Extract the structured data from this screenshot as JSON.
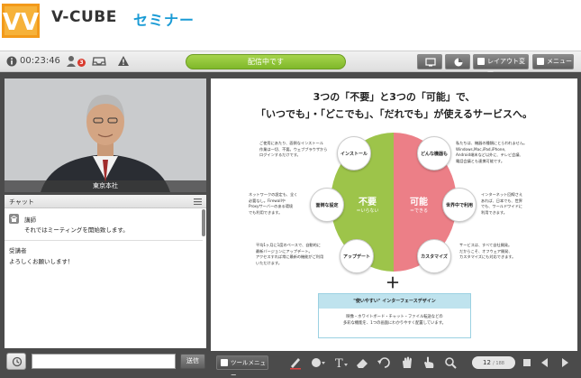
{
  "brand": {
    "name_a": "V-CUBE",
    "name_b": "セミナー",
    "logo_letters": "VV"
  },
  "toolbar": {
    "info_icon": "info-icon",
    "timer": "00:23:46",
    "participants_badge": "3",
    "status": "配信中です",
    "layout_label": "レイアウト変更",
    "menu_label": "メニュー"
  },
  "video": {
    "label": "東京本社"
  },
  "chat": {
    "title": "チャット",
    "messages": [
      {
        "name": "講師",
        "text": "それではミーティングを開始致します。"
      },
      {
        "name": "受講者",
        "text": "よろしくお願いします！"
      }
    ],
    "send_label": "送信",
    "input_value": ""
  },
  "slide": {
    "title_line1": "3つの「不要」と3つの「可能」で、",
    "title_line2": "「いつでも」・「どこでも」、「だれでも」が使えるサービスへ。",
    "left_center": {
      "big": "不要",
      "sub": "＝いらない"
    },
    "right_center": {
      "big": "可能",
      "sub": "＝できる"
    },
    "nodes": {
      "install": "インストール",
      "complex": "面倒な設定",
      "update": "アップデート",
      "device": "どんな機器も",
      "world": "世界中で利用",
      "custom": "カスタマイズ"
    },
    "descs": {
      "install": "ご使用にあたり、面倒なインストール\n作業は一切、不要。ウェブブラウザから\nログインするだけです。",
      "complex": "ネットワークの設定も、全く\n必要なし。Firewallや\nProxyサーバーのある環境\nでも利用できます。",
      "update": "平均1ヶ月に1度のペースで、自動的に\n最新バージョンにアップデート。\nアクセスすれば常に最新の機能がご利用\nいただけます。",
      "device": "私たちは、機器の種類にとらわれません。\nWindows,Mac,iPad,iPhone,\nAndroid端末など以外に、テレビ会議、\n電話会議とも連携可能です。",
      "world": "インターネット回線さえ\nあれば、日本でも、世界\nでも、ワールドワイドに\n利用できます。",
      "custom": "サービスは、すべて自社開発。\nだからこそ、オフウェア開発、\nカスタマイズにも対応できます。"
    },
    "plus": "＋",
    "box_title": "\"使いやすい\" インターフェースデザイン",
    "box_text": "映像・ホワイトボード・チャット・ファイル転送などの\n多彩な機能を、1つの画面にわかりやすく配置しています。"
  },
  "bottom": {
    "tool_menu": "ツールメニュー",
    "page_current": "12",
    "page_total": "/ 188"
  },
  "colors": {
    "green": "#9dc44a",
    "pink": "#ec7f87",
    "accent": "#1a9bd5",
    "live": "#8cc23a"
  }
}
